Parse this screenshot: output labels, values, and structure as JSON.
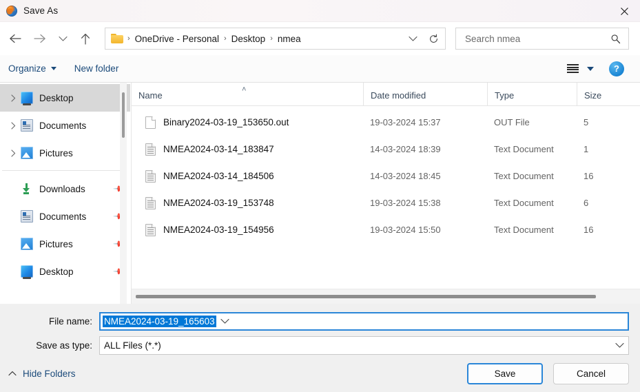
{
  "window": {
    "title": "Save As",
    "app_icon": "globe-icon",
    "close_label": "✕"
  },
  "nav": {
    "back": "back-arrow-icon",
    "forward": "forward-arrow-icon",
    "recent": "chevron-down-icon",
    "up": "up-arrow-icon",
    "breadcrumb": {
      "folder_icon": "folder-icon",
      "separator": "›",
      "items": [
        "OneDrive - Personal",
        "Desktop",
        "nmea"
      ],
      "dropdown_icon": "chevron-down-icon",
      "refresh_icon": "refresh-icon"
    },
    "search": {
      "placeholder": "Search nmea",
      "value": "",
      "icon": "search-icon"
    }
  },
  "commandbar": {
    "organize_label": "Organize",
    "new_folder_label": "New folder",
    "view_icon": "list-view-icon",
    "view_caret_icon": "chevron-down-icon",
    "help_label": "?",
    "link_color": "#1b4a7a"
  },
  "sidebar": {
    "tree_items": [
      {
        "label": "Desktop",
        "icon": "desktop-icon",
        "expander": "›",
        "selected": true,
        "pinned": false
      },
      {
        "label": "Documents",
        "icon": "documents-icon",
        "expander": "›",
        "selected": false,
        "pinned": false
      },
      {
        "label": "Pictures",
        "icon": "pictures-icon",
        "expander": "›",
        "selected": false,
        "pinned": false
      }
    ],
    "quick_items": [
      {
        "label": "Downloads",
        "icon": "downloads-icon",
        "pinned": true,
        "pin_icon": "pin-icon"
      },
      {
        "label": "Documents",
        "icon": "documents-icon",
        "pinned": true,
        "pin_icon": "pin-icon"
      },
      {
        "label": "Pictures",
        "icon": "pictures-icon",
        "pinned": true,
        "pin_icon": "pin-icon"
      },
      {
        "label": "Desktop",
        "icon": "desktop-icon",
        "pinned": true,
        "pin_icon": "pin-icon"
      }
    ]
  },
  "filelist": {
    "columns": [
      "Name",
      "Date modified",
      "Type",
      "Size"
    ],
    "sort_column": "Name",
    "sort_caret": "˄",
    "rows": [
      {
        "name": "Binary2024-03-19_153650.out",
        "date": "19-03-2024 15:37",
        "type": "OUT File",
        "size": "5",
        "icon": "blank-file-icon"
      },
      {
        "name": "NMEA2024-03-14_183847",
        "date": "14-03-2024 18:39",
        "type": "Text Document",
        "size": "1",
        "icon": "text-file-icon"
      },
      {
        "name": "NMEA2024-03-14_184506",
        "date": "14-03-2024 18:45",
        "type": "Text Document",
        "size": "16",
        "icon": "text-file-icon"
      },
      {
        "name": "NMEA2024-03-19_153748",
        "date": "19-03-2024 15:38",
        "type": "Text Document",
        "size": "6",
        "icon": "text-file-icon"
      },
      {
        "name": "NMEA2024-03-19_154956",
        "date": "19-03-2024 15:50",
        "type": "Text Document",
        "size": "16",
        "icon": "text-file-icon"
      }
    ]
  },
  "form": {
    "filename_label": "File name:",
    "filename_value": "NMEA2024-03-19_165603",
    "filename_selected": true,
    "savetype_label": "Save as type:",
    "savetype_value": "ALL Files (*.*)",
    "chevron_icon": "chevron-down-icon"
  },
  "footer": {
    "hide_folders_label": "Hide Folders",
    "hide_folders_icon": "chevron-up-icon",
    "save_label": "Save",
    "cancel_label": "Cancel"
  },
  "colors": {
    "accent": "#0078d7",
    "default_button_border": "#2a86d8",
    "link": "#1b4a7a",
    "selection": "#0078d7"
  }
}
